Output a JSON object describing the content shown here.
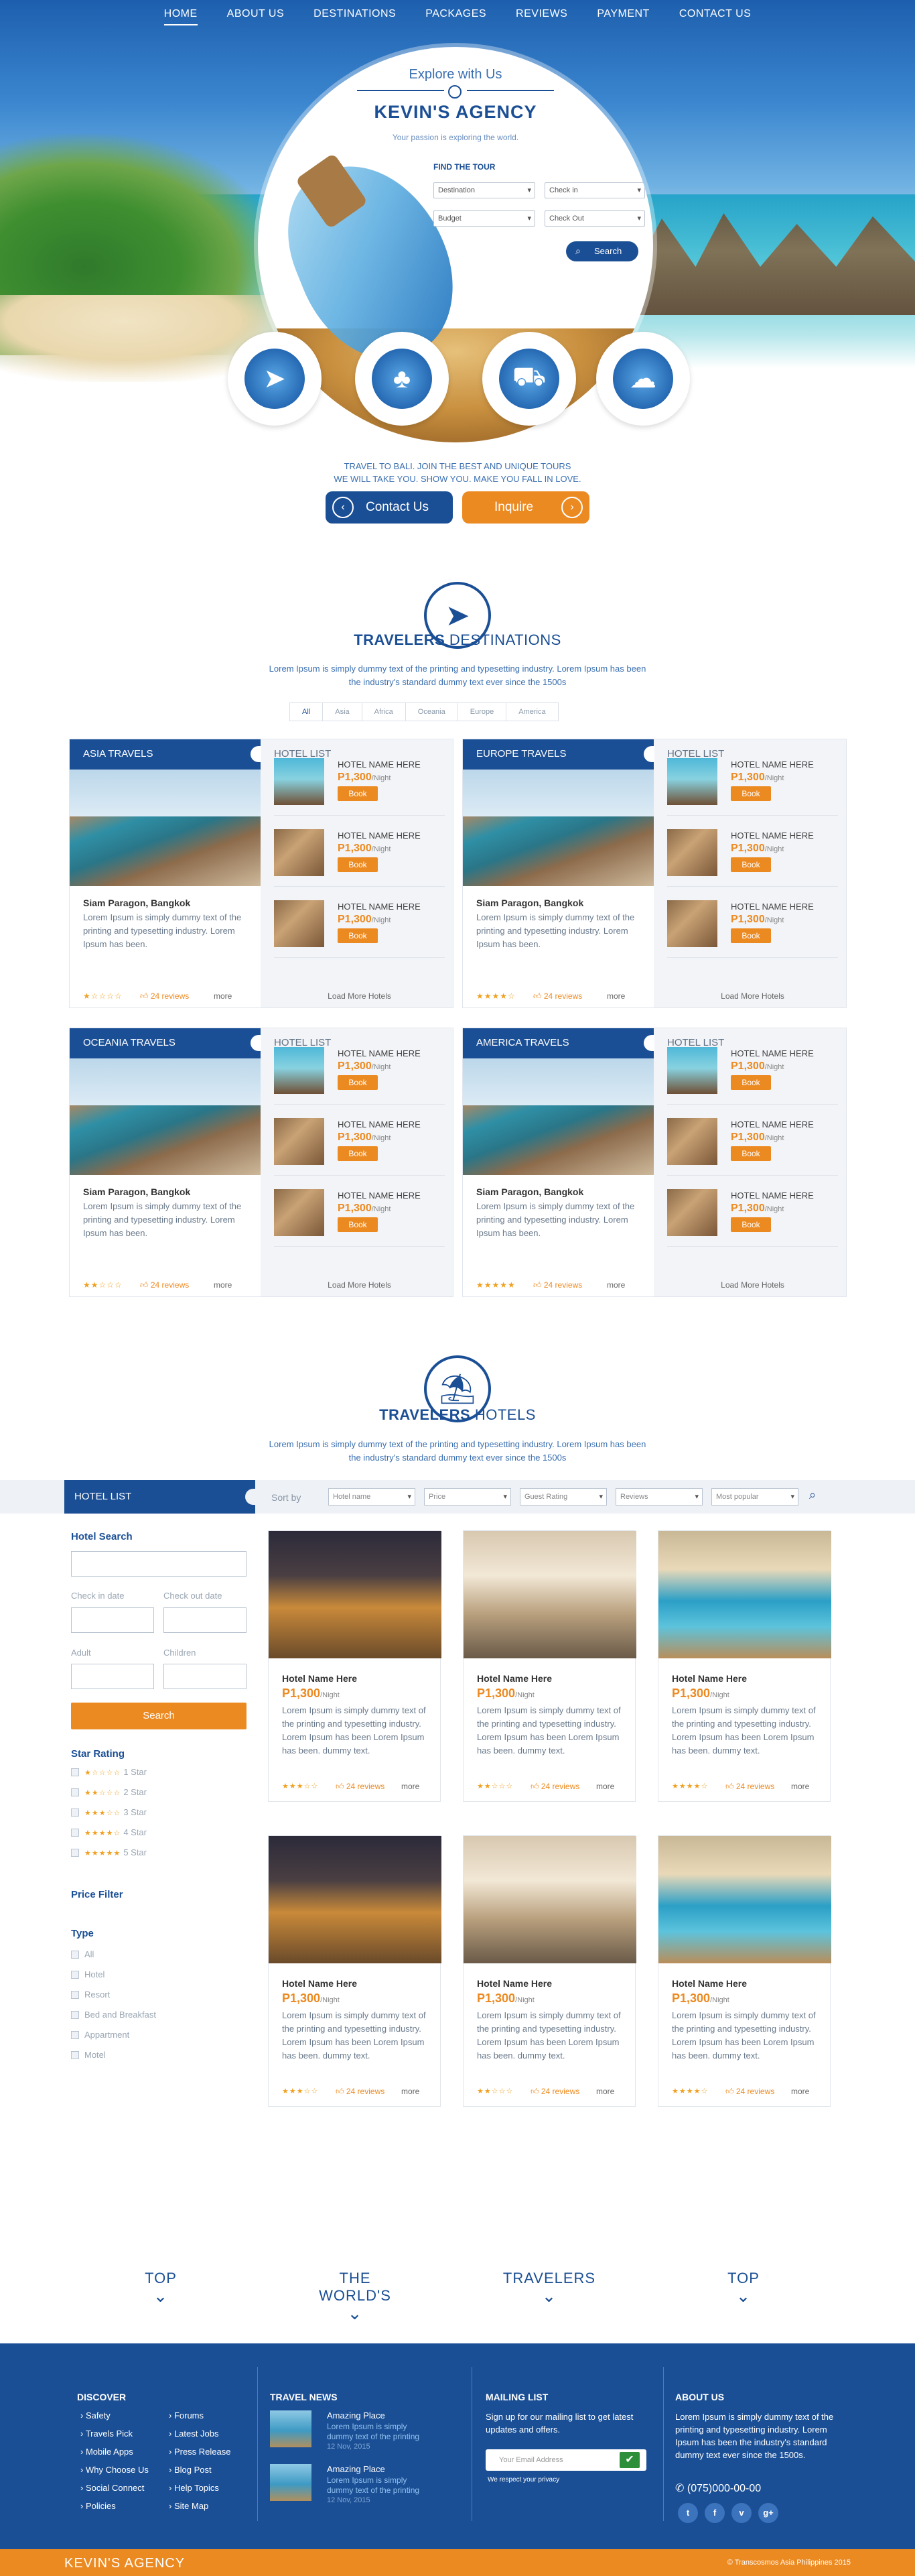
{
  "nav": [
    "HOME",
    "ABOUT US",
    "DESTINATIONS",
    "PACKAGES",
    "REVIEWS",
    "PAYMENT",
    "CONTACT US"
  ],
  "hero": {
    "explore": "Explore with Us",
    "agency": "KEVIN'S AGENCY",
    "tagline": "Your passion is exploring the world.",
    "find_tour": "FIND THE TOUR",
    "fields": [
      "Destination",
      "Check in",
      "Budget",
      "Check Out"
    ],
    "search": "Search",
    "text_line1": "TRAVEL TO BALI. JOIN THE BEST AND UNIQUE TOURS",
    "text_line2": "WE WILL TAKE YOU. SHOW YOU. MAKE YOU FALL IN LOVE.",
    "contact": "Contact Us",
    "inquire": "Inquire"
  },
  "destinations": {
    "title_bold": "TRAVELERS",
    "title_rest": "DESTINATIONS",
    "desc1": "Lorem Ipsum is simply dummy text of the printing and typesetting industry. Lorem Ipsum has been",
    "desc2": "the industry's standard dummy text ever since the 1500s",
    "tabs": [
      "All",
      "Asia",
      "Africa",
      "Oceania",
      "Europe",
      "America"
    ],
    "hotel_list": "HOTEL LIST",
    "hotel_name": "HOTEL NAME HERE",
    "price": "P1,300",
    "per_night": "/Night",
    "book": "Book",
    "load_more": "Load More Hotels",
    "place": "Siam Paragon, Bangkok",
    "place_desc": "Lorem Ipsum is simply dummy text of the printing and typesetting industry. Lorem Ipsum has been.",
    "reviews": "24 reviews",
    "more": "more",
    "panels": [
      {
        "title": "ASIA TRAVELS",
        "stars": "★☆☆☆☆"
      },
      {
        "title": "EUROPE TRAVELS",
        "stars": "★★★★☆"
      },
      {
        "title": "OCEANIA TRAVELS",
        "stars": "★★☆☆☆"
      },
      {
        "title": "AMERICA TRAVELS",
        "stars": "★★★★★"
      }
    ]
  },
  "hotels": {
    "title_bold": "TRAVELERS",
    "title_rest": "HOTELS",
    "desc1": "Lorem Ipsum is simply dummy text of the printing and typesetting industry. Lorem Ipsum has been",
    "desc2": "the industry's standard dummy text ever since the 1500s",
    "list_label": "HOTEL LIST",
    "sort_by": "Sort by",
    "sorts": [
      "Hotel name",
      "Price",
      "Guest Rating",
      "Reviews",
      "Most popular"
    ],
    "sidebar": {
      "hotel_search": "Hotel Search",
      "check_in": "Check in date",
      "check_out": "Check out date",
      "adult": "Adult",
      "children": "Children",
      "search": "Search",
      "star_rating": "Star Rating",
      "star_labels": [
        "1 Star",
        "2 Star",
        "3 Star",
        "4 Star",
        "5 Star"
      ],
      "price_filter": "Price Filter",
      "type": "Type",
      "types": [
        "All",
        "Hotel",
        "Resort",
        "Bed and Breakfast",
        "Appartment",
        "Motel"
      ]
    },
    "card_name": "Hotel Name Here",
    "card_price": "P1,300",
    "card_night": "/Night",
    "card_desc": "Lorem Ipsum is simply dummy text of the printing and typesetting industry. Lorem Ipsum has been Lorem Ipsum has been. dummy text.",
    "card_reviews": "24 reviews",
    "card_more": "more",
    "card_stars": [
      "★★★☆☆",
      "★★☆☆☆",
      "★★★★☆",
      "★★★☆☆",
      "★★☆☆☆",
      "★★★★☆"
    ]
  },
  "strip": [
    "TOP",
    "THE WORLD'S",
    "TRAVELERS",
    "TOP"
  ],
  "footer": {
    "discover": "DISCOVER",
    "links_col1": [
      "Safety",
      "Travels Pick",
      "Mobile Apps",
      "Why Choose Us",
      "Social Connect",
      "Policies"
    ],
    "links_col2": [
      "Forums",
      "Latest Jobs",
      "Press Release",
      "Blog Post",
      "Help Topics",
      "Site Map"
    ],
    "travel_news": "TRAVEL NEWS",
    "news": [
      {
        "title": "Amazing Place",
        "desc": "Lorem Ipsum is simply dummy text of the printing",
        "date": "12 Nov, 2015"
      },
      {
        "title": "Amazing Place",
        "desc": "Lorem Ipsum is simply dummy text of the printing",
        "date": "12 Nov, 2015"
      }
    ],
    "mailing_list": "MAILING LIST",
    "mailing_text": "Sign up for our mailing list to get latest updates and offers.",
    "email_placeholder": "Your Email Address",
    "privacy": "We respect your privacy",
    "about": "ABOUT US",
    "about_text": "Lorem Ipsum is simply dummy text of the printing and typesetting industry. Lorem Ipsum has been the industry's standard dummy text ever since the 1500s.",
    "phone": "(075)000-00-00",
    "brand": "KEVIN'S AGENCY",
    "copyright": "© Transcosmos Asia Philippines 2015"
  },
  "colors": {
    "primary": "#1b4f95",
    "accent": "#ec8a22"
  }
}
